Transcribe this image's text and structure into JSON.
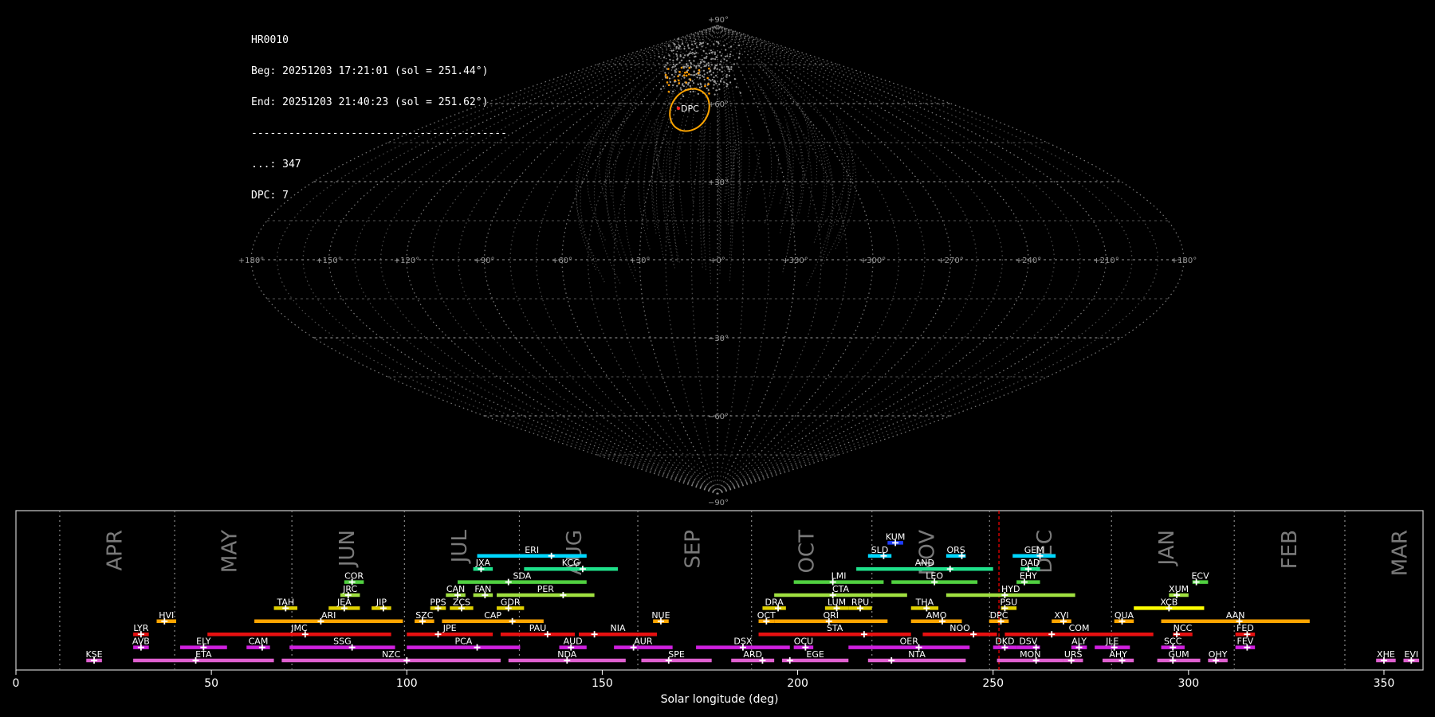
{
  "info": {
    "station": "HR0010",
    "beg": "Beg: 20251203 17:21:01 (sol = 251.44°)",
    "end": "End: 20251203 21:40:23 (sol = 251.62°)",
    "rule": "-----------------------------------------",
    "total": "...: 347",
    "dpc": "DPC: 7"
  },
  "sky": {
    "lon_labels": [
      "+180°",
      "+150°",
      "+120°",
      "+90°",
      "+60°",
      "+30°",
      "+0°",
      "+330°",
      "+300°",
      "+270°",
      "+240°",
      "+210°",
      "+180°"
    ],
    "lat_labels": [
      "+90°",
      "+60°",
      "+30°",
      "−30°",
      "−60°",
      "−90°"
    ],
    "radiant_label": "DPC",
    "colors": {
      "grid": "#8a8a8a",
      "radiants": "#9a9a9a",
      "highlight": "#ff9900",
      "circle": "#ffa500"
    }
  },
  "chart_data": {
    "type": "bar",
    "xlabel": "Solar longitude (deg)",
    "xlim": [
      0,
      360
    ],
    "xticks": [
      0,
      50,
      100,
      150,
      200,
      250,
      300,
      350
    ],
    "current_sol": 251.5,
    "current_color": "#ff0000",
    "months": [
      {
        "name": "APR",
        "boundary": 11.2
      },
      {
        "name": "MAY",
        "boundary": 40.6
      },
      {
        "name": "JUN",
        "boundary": 70.6
      },
      {
        "name": "JUL",
        "boundary": 99.4
      },
      {
        "name": "AUG",
        "boundary": 128.8
      },
      {
        "name": "SEP",
        "boundary": 159.1
      },
      {
        "name": "OCT",
        "boundary": 188.2
      },
      {
        "name": "NOV",
        "boundary": 219.0
      },
      {
        "name": "DEC",
        "boundary": 249.1
      },
      {
        "name": "JAN",
        "boundary": 280.3
      },
      {
        "name": "FEB",
        "boundary": 311.7
      },
      {
        "name": "MAR",
        "boundary": 340.0
      }
    ],
    "showers": [
      {
        "code": "KUM",
        "start": 223,
        "end": 227,
        "peak": 225,
        "row": 10,
        "color": "#1e3cff"
      },
      {
        "code": "ERI",
        "start": 118,
        "end": 146,
        "peak": 137,
        "row": 9,
        "color": "#00d8ff"
      },
      {
        "code": "SLD",
        "start": 218,
        "end": 224,
        "peak": 222,
        "row": 9,
        "color": "#00d8ff"
      },
      {
        "code": "ORS",
        "start": 238,
        "end": 243,
        "peak": 242,
        "row": 9,
        "color": "#00d8ff"
      },
      {
        "code": "GEM",
        "start": 255,
        "end": 266,
        "peak": 262,
        "row": 9,
        "color": "#00d8ff"
      },
      {
        "code": "JXA",
        "start": 117,
        "end": 122,
        "peak": 119,
        "row": 8,
        "color": "#1ee08a"
      },
      {
        "code": "KCG",
        "start": 130,
        "end": 154,
        "peak": 145,
        "row": 8,
        "color": "#1ee08a"
      },
      {
        "code": "AND",
        "start": 215,
        "end": 250,
        "peak": 239,
        "row": 8,
        "color": "#1ee08a"
      },
      {
        "code": "DAD",
        "start": 257,
        "end": 262,
        "peak": 259,
        "row": 8,
        "color": "#1ee08a"
      },
      {
        "code": "COR",
        "start": 84,
        "end": 89,
        "peak": 86,
        "row": 7,
        "color": "#50d040"
      },
      {
        "code": "SDA",
        "start": 113,
        "end": 146,
        "peak": 126,
        "row": 7,
        "color": "#50d040"
      },
      {
        "code": "LMI",
        "start": 199,
        "end": 222,
        "peak": 209,
        "row": 7,
        "color": "#50d040"
      },
      {
        "code": "LEO",
        "start": 224,
        "end": 246,
        "peak": 235,
        "row": 7,
        "color": "#50d040"
      },
      {
        "code": "EHY",
        "start": 256,
        "end": 262,
        "peak": 258,
        "row": 7,
        "color": "#50d040"
      },
      {
        "code": "ECV",
        "start": 301,
        "end": 305,
        "peak": 302,
        "row": 7,
        "color": "#50d040"
      },
      {
        "code": "JRC",
        "start": 83,
        "end": 88,
        "peak": 85,
        "row": 6,
        "color": "#a0e040"
      },
      {
        "code": "CAN",
        "start": 110,
        "end": 115,
        "peak": 113,
        "row": 6,
        "color": "#a0e040"
      },
      {
        "code": "FAN",
        "start": 117,
        "end": 122,
        "peak": 120,
        "row": 6,
        "color": "#a0e040"
      },
      {
        "code": "PER",
        "start": 123,
        "end": 148,
        "peak": 140,
        "row": 6,
        "color": "#a0e040"
      },
      {
        "code": "CTA",
        "start": 194,
        "end": 228,
        "peak": 209,
        "row": 6,
        "color": "#a0e040"
      },
      {
        "code": "HYD",
        "start": 238,
        "end": 271,
        "peak": 253,
        "row": 6,
        "color": "#a0e040"
      },
      {
        "code": "XUM",
        "start": 295,
        "end": 300,
        "peak": 297,
        "row": 6,
        "color": "#a0e040"
      },
      {
        "code": "TAH",
        "start": 66,
        "end": 72,
        "peak": 69,
        "row": 5,
        "color": "#e0d000"
      },
      {
        "code": "JEA",
        "start": 80,
        "end": 88,
        "peak": 84,
        "row": 5,
        "color": "#e0d000"
      },
      {
        "code": "JIP",
        "start": 91,
        "end": 96,
        "peak": 94,
        "row": 5,
        "color": "#e0d000"
      },
      {
        "code": "PPS",
        "start": 106,
        "end": 110,
        "peak": 108,
        "row": 5,
        "color": "#e0d000"
      },
      {
        "code": "ZCS",
        "start": 111,
        "end": 117,
        "peak": 114,
        "row": 5,
        "color": "#e0d000"
      },
      {
        "code": "GDR",
        "start": 123,
        "end": 130,
        "peak": 126,
        "row": 5,
        "color": "#e0d000"
      },
      {
        "code": "DRA",
        "start": 191,
        "end": 197,
        "peak": 195,
        "row": 5,
        "color": "#e0d000"
      },
      {
        "code": "LUM",
        "start": 207,
        "end": 213,
        "peak": 210,
        "row": 5,
        "color": "#e0d000"
      },
      {
        "code": "RPU",
        "start": 213,
        "end": 219,
        "peak": 216,
        "row": 5,
        "color": "#e0d000"
      },
      {
        "code": "THA",
        "start": 229,
        "end": 236,
        "peak": 233,
        "row": 5,
        "color": "#e0d000"
      },
      {
        "code": "PSU",
        "start": 252,
        "end": 256,
        "peak": 253,
        "row": 5,
        "color": "#e0d000"
      },
      {
        "code": "XCB",
        "start": 286,
        "end": 304,
        "peak": 295,
        "row": 5,
        "color": "#ffff00"
      },
      {
        "code": "HVI",
        "start": 36,
        "end": 41,
        "peak": 38,
        "row": 4,
        "color": "#ffa500"
      },
      {
        "code": "ARI",
        "start": 61,
        "end": 99,
        "peak": 78,
        "row": 4,
        "color": "#ffa500"
      },
      {
        "code": "SZC",
        "start": 102,
        "end": 107,
        "peak": 104,
        "row": 4,
        "color": "#ffa500"
      },
      {
        "code": "CAP",
        "start": 109,
        "end": 135,
        "peak": 127,
        "row": 4,
        "color": "#ffa500"
      },
      {
        "code": "NUE",
        "start": 163,
        "end": 167,
        "peak": 165,
        "row": 4,
        "color": "#ffa500"
      },
      {
        "code": "OCT",
        "start": 190,
        "end": 194,
        "peak": 192,
        "row": 4,
        "color": "#ffa500"
      },
      {
        "code": "ORI",
        "start": 194,
        "end": 223,
        "peak": 208,
        "row": 4,
        "color": "#ffa500"
      },
      {
        "code": "AMO",
        "start": 229,
        "end": 242,
        "peak": 237,
        "row": 4,
        "color": "#ffa500"
      },
      {
        "code": "DPC",
        "start": 249,
        "end": 254,
        "peak": 252,
        "row": 4,
        "color": "#ffa500"
      },
      {
        "code": "XVI",
        "start": 265,
        "end": 270,
        "peak": 268,
        "row": 4,
        "color": "#ffa500"
      },
      {
        "code": "QUA",
        "start": 281,
        "end": 286,
        "peak": 283,
        "row": 4,
        "color": "#ffa500"
      },
      {
        "code": "AAN",
        "start": 293,
        "end": 331,
        "peak": 313,
        "row": 4,
        "color": "#ffa500"
      },
      {
        "code": "LYR",
        "start": 30,
        "end": 34,
        "peak": 32,
        "row": 3,
        "color": "#e81010"
      },
      {
        "code": "JMC",
        "start": 49,
        "end": 96,
        "peak": 74,
        "row": 3,
        "color": "#e81010"
      },
      {
        "code": "JPE",
        "start": 100,
        "end": 122,
        "peak": 108,
        "row": 3,
        "color": "#e81010"
      },
      {
        "code": "PAU",
        "start": 124,
        "end": 143,
        "peak": 136,
        "row": 3,
        "color": "#e81010"
      },
      {
        "code": "NIA",
        "start": 144,
        "end": 164,
        "peak": 148,
        "row": 3,
        "color": "#e81010"
      },
      {
        "code": "STA",
        "start": 190,
        "end": 229,
        "peak": 217,
        "row": 3,
        "color": "#e81010"
      },
      {
        "code": "NOO",
        "start": 232,
        "end": 251,
        "peak": 245,
        "row": 3,
        "color": "#e81010"
      },
      {
        "code": "COM",
        "start": 253,
        "end": 291,
        "peak": 265,
        "row": 3,
        "color": "#e81010"
      },
      {
        "code": "NCC",
        "start": 296,
        "end": 301,
        "peak": 297,
        "row": 3,
        "color": "#e81010"
      },
      {
        "code": "FED",
        "start": 312,
        "end": 317,
        "peak": 315,
        "row": 3,
        "color": "#e81010"
      },
      {
        "code": "AVB",
        "start": 30,
        "end": 34,
        "peak": 32,
        "row": 2,
        "color": "#d020e0"
      },
      {
        "code": "ELY",
        "start": 42,
        "end": 54,
        "peak": 48,
        "row": 2,
        "color": "#d020e0"
      },
      {
        "code": "CAM",
        "start": 59,
        "end": 65,
        "peak": 63,
        "row": 2,
        "color": "#d020e0"
      },
      {
        "code": "SSG",
        "start": 70,
        "end": 97,
        "peak": 86,
        "row": 2,
        "color": "#d020e0"
      },
      {
        "code": "PCA",
        "start": 100,
        "end": 129,
        "peak": 118,
        "row": 2,
        "color": "#d020e0"
      },
      {
        "code": "AUD",
        "start": 139,
        "end": 146,
        "peak": 142,
        "row": 2,
        "color": "#d020e0"
      },
      {
        "code": "AUR",
        "start": 153,
        "end": 168,
        "peak": 158,
        "row": 2,
        "color": "#d020e0"
      },
      {
        "code": "DSX",
        "start": 174,
        "end": 198,
        "peak": 186,
        "row": 2,
        "color": "#d020e0"
      },
      {
        "code": "OCU",
        "start": 199,
        "end": 204,
        "peak": 202,
        "row": 2,
        "color": "#d020e0"
      },
      {
        "code": "OER",
        "start": 213,
        "end": 244,
        "peak": 231,
        "row": 2,
        "color": "#d020e0"
      },
      {
        "code": "DKD",
        "start": 250,
        "end": 256,
        "peak": 253,
        "row": 2,
        "color": "#d020e0"
      },
      {
        "code": "DSV",
        "start": 256,
        "end": 262,
        "peak": 261,
        "row": 2,
        "color": "#d020e0"
      },
      {
        "code": "ALY",
        "start": 270,
        "end": 274,
        "peak": 272,
        "row": 2,
        "color": "#d020e0"
      },
      {
        "code": "JLE",
        "start": 276,
        "end": 285,
        "peak": 281,
        "row": 2,
        "color": "#d020e0"
      },
      {
        "code": "SCC",
        "start": 293,
        "end": 299,
        "peak": 296,
        "row": 2,
        "color": "#d020e0"
      },
      {
        "code": "FEV",
        "start": 312,
        "end": 317,
        "peak": 315,
        "row": 2,
        "color": "#d020e0"
      },
      {
        "code": "KSE",
        "start": 18,
        "end": 22,
        "peak": 20,
        "row": 1,
        "color": "#e060d0"
      },
      {
        "code": "ETA",
        "start": 30,
        "end": 66,
        "peak": 46,
        "row": 1,
        "color": "#e060d0"
      },
      {
        "code": "NZC",
        "start": 68,
        "end": 124,
        "peak": 100,
        "row": 1,
        "color": "#e060d0"
      },
      {
        "code": "NDA",
        "start": 126,
        "end": 156,
        "peak": 141,
        "row": 1,
        "color": "#e060d0"
      },
      {
        "code": "SPE",
        "start": 160,
        "end": 178,
        "peak": 167,
        "row": 1,
        "color": "#e060d0"
      },
      {
        "code": "ARD",
        "start": 183,
        "end": 194,
        "peak": 191,
        "row": 1,
        "color": "#e060d0"
      },
      {
        "code": "EGE",
        "start": 196,
        "end": 213,
        "peak": 198,
        "row": 1,
        "color": "#e060d0"
      },
      {
        "code": "NTA",
        "start": 218,
        "end": 243,
        "peak": 224,
        "row": 1,
        "color": "#e060d0"
      },
      {
        "code": "MON",
        "start": 251,
        "end": 268,
        "peak": 261,
        "row": 1,
        "color": "#e060d0"
      },
      {
        "code": "URS",
        "start": 268,
        "end": 273,
        "peak": 270,
        "row": 1,
        "color": "#e060d0"
      },
      {
        "code": "AHY",
        "start": 278,
        "end": 286,
        "peak": 283,
        "row": 1,
        "color": "#e060d0"
      },
      {
        "code": "GUM",
        "start": 292,
        "end": 303,
        "peak": 296,
        "row": 1,
        "color": "#e060d0"
      },
      {
        "code": "OHY",
        "start": 305,
        "end": 310,
        "peak": 307,
        "row": 1,
        "color": "#e060d0"
      },
      {
        "code": "XHE",
        "start": 348,
        "end": 353,
        "peak": 350,
        "row": 1,
        "color": "#e060d0"
      },
      {
        "code": "EVI",
        "start": 355,
        "end": 359,
        "peak": 357,
        "row": 1,
        "color": "#e060d0"
      }
    ]
  }
}
